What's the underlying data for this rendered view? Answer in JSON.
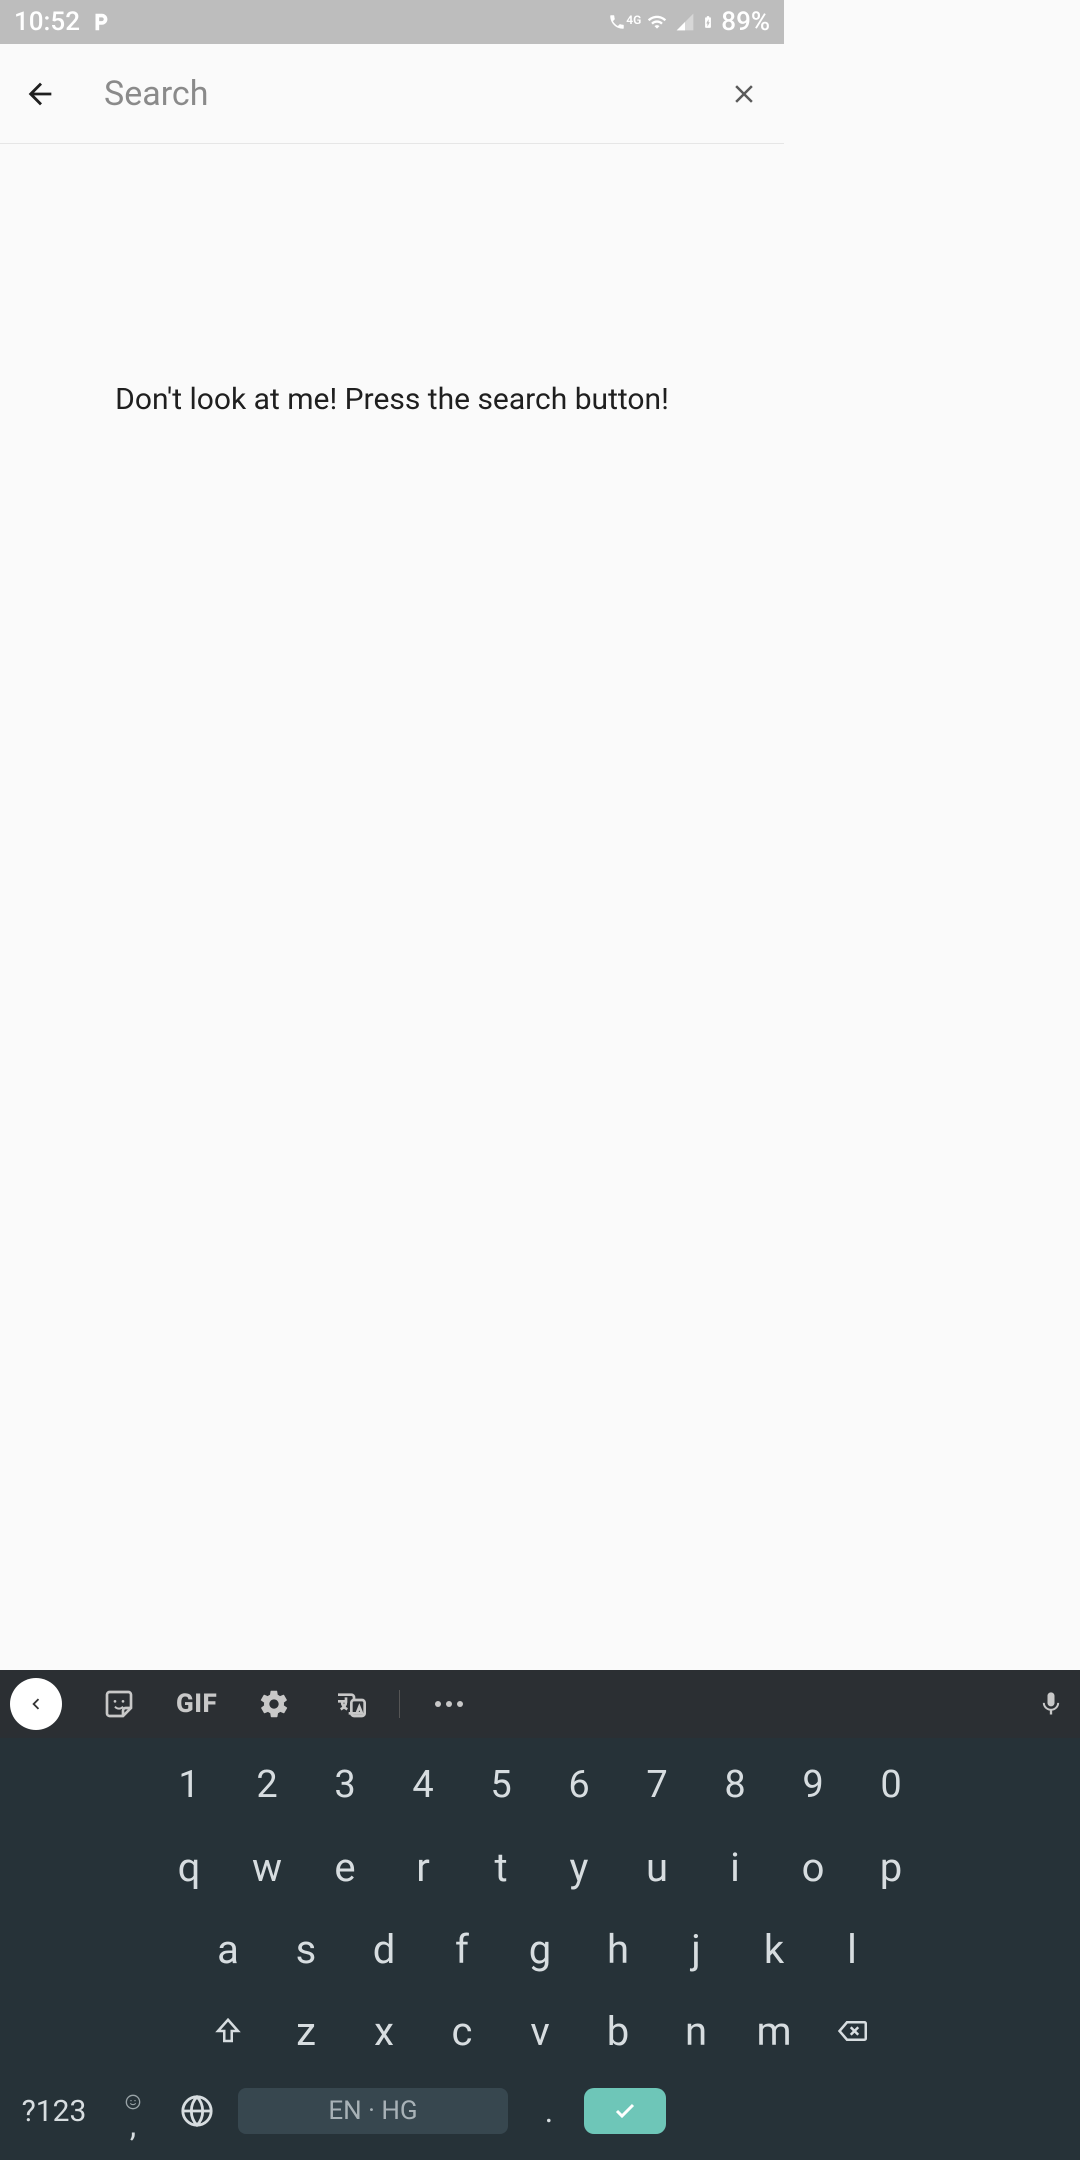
{
  "status": {
    "time": "10:52",
    "battery_pct": "89%",
    "network_label": "4G"
  },
  "appbar": {
    "search_placeholder": "Search",
    "search_value": ""
  },
  "content": {
    "empty_message": "Don't look at me! Press the search button!"
  },
  "keyboard": {
    "gif_label": "GIF",
    "row_numbers": [
      "1",
      "2",
      "3",
      "4",
      "5",
      "6",
      "7",
      "8",
      "9",
      "0"
    ],
    "row_qwerty": [
      "q",
      "w",
      "e",
      "r",
      "t",
      "y",
      "u",
      "i",
      "o",
      "p"
    ],
    "row_asdf": [
      "a",
      "s",
      "d",
      "f",
      "g",
      "h",
      "j",
      "k",
      "l"
    ],
    "row_zxcv": [
      "z",
      "x",
      "c",
      "v",
      "b",
      "n",
      "m"
    ],
    "symbols_label": "?123",
    "comma_label": ",",
    "space_label": "EN · HG",
    "period_label": "."
  }
}
